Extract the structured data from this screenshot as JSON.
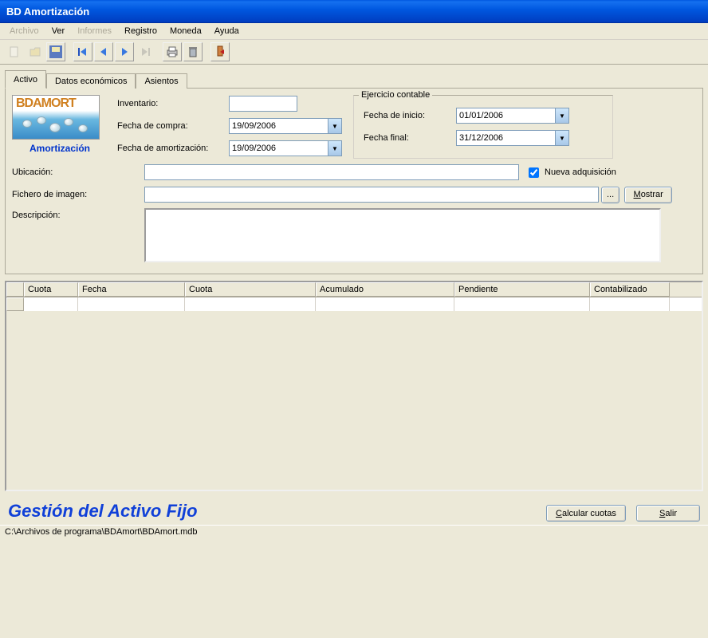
{
  "window": {
    "title": "BD Amortización"
  },
  "menu": {
    "archivo": "Archivo",
    "ver": "Ver",
    "informes": "Informes",
    "registro": "Registro",
    "moneda": "Moneda",
    "ayuda": "Ayuda"
  },
  "tabs": {
    "activo": "Activo",
    "datos_economicos": "Datos económicos",
    "asientos": "Asientos"
  },
  "logo": {
    "text": "BDAMORT",
    "caption": "Amortización"
  },
  "form": {
    "inventario_label": "Inventario:",
    "inventario_value": "",
    "fecha_compra_label": "Fecha de compra:",
    "fecha_compra_value": "19/09/2006",
    "fecha_amort_label": "Fecha de amortización:",
    "fecha_amort_value": "19/09/2006",
    "ubicacion_label": "Ubicación:",
    "ubicacion_value": "",
    "fichero_label": "Fichero de imagen:",
    "fichero_value": "",
    "descripcion_label": "Descripción:",
    "descripcion_value": "",
    "browse_btn": "...",
    "mostrar_btn": "Mostrar",
    "mostrar_key": "M",
    "nueva_adq_label": "Nueva adquisición",
    "nueva_adq_checked": true
  },
  "ejercicio": {
    "legend": "Ejercicio contable",
    "inicio_label": "Fecha de inicio:",
    "inicio_value": "01/01/2006",
    "final_label": "Fecha final:",
    "final_value": "31/12/2006"
  },
  "grid": {
    "cols": [
      "",
      "Cuota",
      "Fecha",
      "Cuota",
      "Acumulado",
      "Pendiente",
      "Contabilizado"
    ],
    "rows": [
      [
        "",
        "",
        "",
        "",
        "",
        "",
        ""
      ]
    ]
  },
  "footer": {
    "brand": "Gestión del Activo Fijo",
    "calcular_btn": "Calcular cuotas",
    "calcular_key": "C",
    "salir_btn": "Salir",
    "salir_key": "S"
  },
  "statusbar": "C:\\Archivos de programa\\BDAmort\\BDAmort.mdb"
}
